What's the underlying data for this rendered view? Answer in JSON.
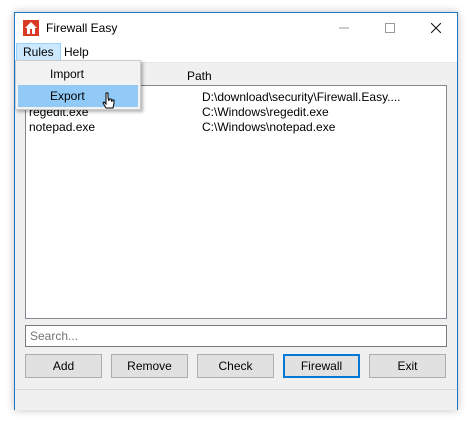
{
  "window": {
    "title": "Firewall Easy"
  },
  "menubar": {
    "items": [
      {
        "label": "Rules"
      },
      {
        "label": "Help"
      }
    ]
  },
  "dropdown": {
    "items": [
      {
        "label": "Import"
      },
      {
        "label": "Export"
      }
    ]
  },
  "list": {
    "columns": [
      "Path"
    ],
    "rows": [
      {
        "name": "",
        "path": "D:\\download\\security\\Firewall.Easy...."
      },
      {
        "name": "regedit.exe",
        "path": "C:\\Windows\\regedit.exe"
      },
      {
        "name": "notepad.exe",
        "path": "C:\\Windows\\notepad.exe"
      }
    ]
  },
  "search": {
    "placeholder": "Search..."
  },
  "buttons": {
    "add": "Add",
    "remove": "Remove",
    "check": "Check",
    "firewall": "Firewall",
    "exit": "Exit"
  },
  "colors": {
    "accent": "#0078d7",
    "menu_highlight": "#91c9f7",
    "title_border": "#1b76c9"
  }
}
